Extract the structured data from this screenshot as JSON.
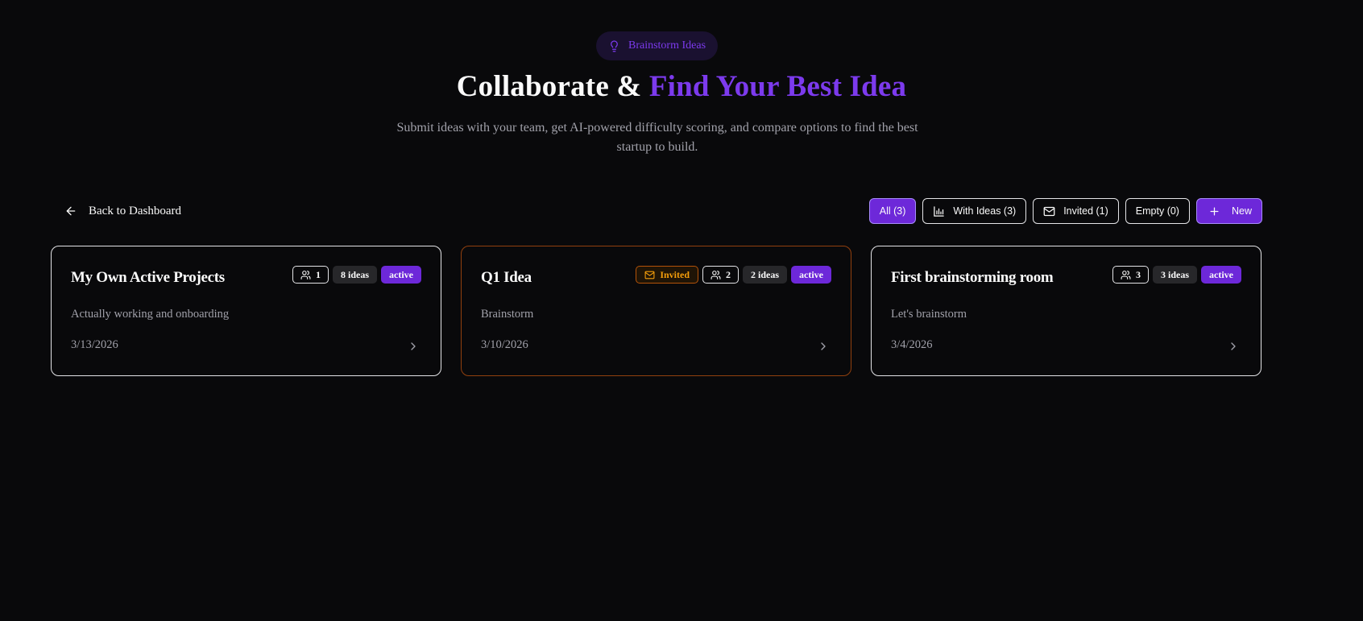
{
  "hero": {
    "pill_label": "Brainstorm Ideas",
    "pill_icon": "lightbulb-icon",
    "title_prefix": "Collaborate & ",
    "title_accent": "Find Your Best Idea",
    "subtitle": "Submit ideas with your team, get AI-powered difficulty scoring, and compare options to find the best startup to build."
  },
  "nav": {
    "back_label": "Back to Dashboard",
    "back_icon": "arrow-left-icon"
  },
  "filters": {
    "all": "All (3)",
    "with_ideas": "With Ideas (3)",
    "invited": "Invited (1)",
    "empty": "Empty (0)",
    "new": "New"
  },
  "cards": [
    {
      "title": "My Own Active Projects",
      "members": "1",
      "ideas": "8 ideas",
      "status": "active",
      "description": "Actually working and onboarding",
      "date": "3/13/2026"
    },
    {
      "title": "Q1 Idea",
      "invited_label": "Invited",
      "members": "2",
      "ideas": "2 ideas",
      "status": "active",
      "description": "Brainstorm",
      "date": "3/10/2026"
    },
    {
      "title": "First brainstorming room",
      "members": "3",
      "ideas": "3 ideas",
      "status": "active",
      "description": "Let's brainstorm",
      "date": "3/4/2026"
    }
  ],
  "colors": {
    "background": "#09090b",
    "accent": "#7c3aed",
    "button_violet": "#6d28d9",
    "invited_amber": "#f59e0b"
  }
}
